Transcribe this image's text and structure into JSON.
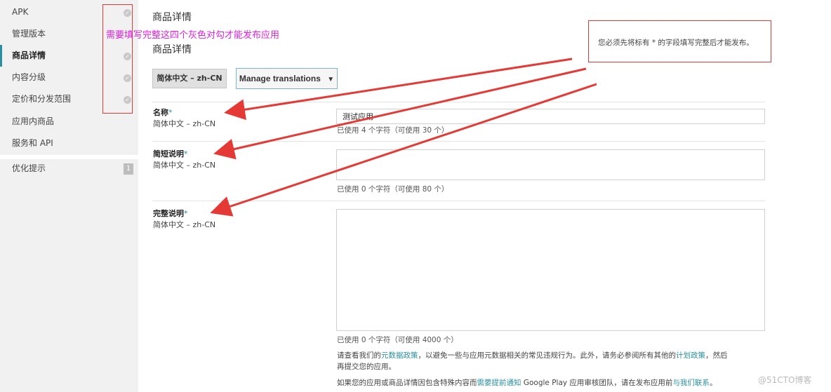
{
  "sidebar": {
    "items": [
      {
        "label": "APK",
        "check": true
      },
      {
        "label": "管理版本",
        "check": false
      },
      {
        "label": "商品详情",
        "check": true,
        "active": true
      },
      {
        "label": "内容分级",
        "check": true
      },
      {
        "label": "定价和分发范围",
        "check": true
      },
      {
        "label": "应用内商品",
        "check": false
      },
      {
        "label": "服务和 API",
        "check": false
      }
    ],
    "optimize": {
      "label": "优化提示",
      "badge": "1"
    }
  },
  "annotation": {
    "text": "需要填写完整这四个灰色对勾才能发布应用"
  },
  "header": {
    "title": "商品详情",
    "subtitle": "商品详情"
  },
  "tabs": {
    "language": "简体中文 – zh-CN",
    "manage": "Manage translations",
    "manage_caret": "▼"
  },
  "notice": {
    "text": "您必须先将标有 * 的字段填写完整后才能发布。"
  },
  "fields": {
    "name": {
      "label": "名称",
      "required": "*",
      "lang": "简体中文 – zh-CN",
      "value": "测试应用",
      "counter": "已使用 4 个字符（可使用 30 个）"
    },
    "short": {
      "label": "简短说明",
      "required": "*",
      "lang": "简体中文 – zh-CN",
      "value": "",
      "counter": "已使用 0 个字符（可使用 80 个）"
    },
    "full": {
      "label": "完整说明",
      "required": "*",
      "lang": "简体中文 – zh-CN",
      "value": "",
      "counter": "已使用 0 个字符（可使用 4000 个）"
    }
  },
  "policy": {
    "p1_a": "请查看我们的",
    "p1_link1": "元数据政策",
    "p1_b": "，以避免一些与应用元数据相关的常见违规行为。此外，请务必参阅所有其他的",
    "p1_link2": "计划政策",
    "p1_c": "，然后",
    "p1_line2": "再提交您的应用。",
    "p2_a": "如果您的应用或商品详情因包含特殊内容而",
    "p2_link1": "需要提前通知",
    "p2_b": " Google Play 应用审核团队，请在发布应用前",
    "p2_link2": "与我们联系",
    "p2_c": "。"
  },
  "watermark": "@51CTO博客",
  "colors": {
    "accent": "#2a8f9f",
    "annotation_red": "#e53935",
    "annotation_magenta": "#e020e0"
  }
}
